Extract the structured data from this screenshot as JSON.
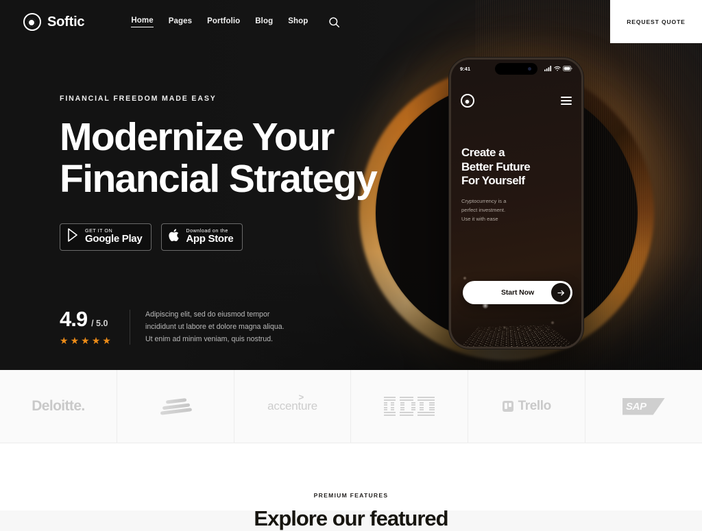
{
  "header": {
    "brand": {
      "name": "Softic",
      "logo_icon": "softic-ring-logo-icon"
    },
    "nav": [
      {
        "label": "Home",
        "active": true
      },
      {
        "label": "Pages",
        "active": false
      },
      {
        "label": "Portfolio",
        "active": false
      },
      {
        "label": "Blog",
        "active": false
      },
      {
        "label": "Shop",
        "active": false
      }
    ],
    "search_icon": "search-icon",
    "quote_button": "REQUEST QUOTE"
  },
  "hero": {
    "eyebrow": "FINANCIAL FREEDOM MADE EASY",
    "title_line1": "Modernize Your",
    "title_line2": "Financial Strategy",
    "stores": [
      {
        "icon": "google-play-icon",
        "sub": "GET IT ON",
        "main": "Google Play"
      },
      {
        "icon": "apple-logo-icon",
        "sub": "Download on the",
        "main": "App Store"
      }
    ],
    "rating": {
      "score": "4.9",
      "out_of": "/ 5.0",
      "stars": 5,
      "star_color": "#eb8b18",
      "text_line1": "Adipiscing elit, sed do eiusmod tempor",
      "text_line2": "incididunt ut labore et dolore magna aliqua.",
      "text_line3": "Ut enim ad minim veniam, quis nostrud."
    },
    "accent_color": "#eb8b18",
    "background_color": "#151515"
  },
  "phone": {
    "status": {
      "time": "9:41",
      "signal_icon": "cellular-signal-icon",
      "wifi_icon": "wifi-icon",
      "battery_icon": "battery-icon"
    },
    "logo_icon": "softic-ring-logo-icon",
    "menu_icon": "hamburger-menu-icon",
    "title_line1": "Create a",
    "title_line2": "Better Future",
    "title_line3": "For Yourself",
    "sub_line1": "Cryptocurrency is a",
    "sub_line2": "perfect investment.",
    "sub_line3": "Use it with ease",
    "cta_label": "Start Now",
    "cta_icon": "arrow-right-icon"
  },
  "logos": [
    {
      "name": "Deloitte.",
      "icon": "deloitte-logo-icon"
    },
    {
      "name": "Bank of America",
      "icon": "bank-of-america-logo-icon"
    },
    {
      "name": "accenture",
      "icon": "accenture-logo-icon"
    },
    {
      "name": "IBM",
      "icon": "ibm-logo-icon"
    },
    {
      "name": "Trello",
      "icon": "trello-logo-icon"
    },
    {
      "name": "SAP",
      "icon": "sap-logo-icon"
    }
  ],
  "features": {
    "eyebrow": "PREMIUM FEATURES",
    "title": "Explore our featured"
  }
}
